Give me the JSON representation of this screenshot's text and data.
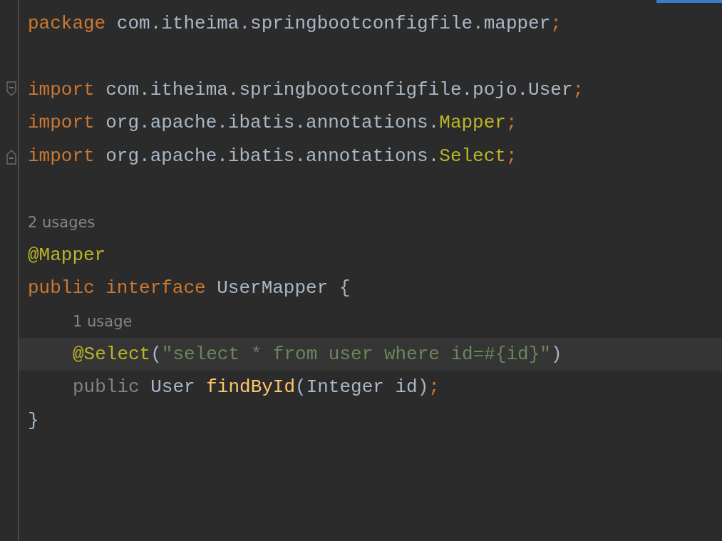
{
  "editor": {
    "lines": [
      {
        "kind": "code",
        "current": false,
        "fold_start": false,
        "fold_end": false,
        "tokens": [
          {
            "text": "package ",
            "kind": "keyword"
          },
          {
            "text": "com.itheima.springbootconfigfile.mapper",
            "kind": "plain"
          },
          {
            "text": ";",
            "kind": "keyword"
          }
        ]
      },
      {
        "kind": "blank"
      },
      {
        "kind": "code",
        "current": false,
        "fold_start": true,
        "fold_end": false,
        "tokens": [
          {
            "text": "import ",
            "kind": "keyword"
          },
          {
            "text": "com.itheima.springbootconfigfile.pojo.User",
            "kind": "plain"
          },
          {
            "text": ";",
            "kind": "keyword"
          }
        ]
      },
      {
        "kind": "code",
        "current": false,
        "fold_start": false,
        "fold_end": false,
        "tokens": [
          {
            "text": "import ",
            "kind": "keyword"
          },
          {
            "text": "org.apache.ibatis.annotations.",
            "kind": "plain"
          },
          {
            "text": "Mapper",
            "kind": "annotation"
          },
          {
            "text": ";",
            "kind": "keyword"
          }
        ]
      },
      {
        "kind": "code",
        "current": false,
        "fold_start": false,
        "fold_end": true,
        "tokens": [
          {
            "text": "import ",
            "kind": "keyword"
          },
          {
            "text": "org.apache.ibatis.annotations.",
            "kind": "plain"
          },
          {
            "text": "Select",
            "kind": "annotation"
          },
          {
            "text": ";",
            "kind": "keyword"
          }
        ]
      },
      {
        "kind": "blank"
      },
      {
        "kind": "hint",
        "current": false,
        "fold_start": false,
        "fold_end": false,
        "text": "2 usages"
      },
      {
        "kind": "code",
        "current": false,
        "fold_start": false,
        "fold_end": false,
        "tokens": [
          {
            "text": "@Mapper",
            "kind": "annotation"
          }
        ]
      },
      {
        "kind": "code",
        "current": false,
        "fold_start": false,
        "fold_end": false,
        "tokens": [
          {
            "text": "public ",
            "kind": "keyword"
          },
          {
            "text": "interface ",
            "kind": "keyword"
          },
          {
            "text": "UserMapper {",
            "kind": "plain"
          }
        ],
        "children": [
          {
            "kind": "hint",
            "current": false,
            "fold_start": false,
            "fold_end": false,
            "text": "1 usage"
          },
          {
            "kind": "code",
            "current": true,
            "fold_start": false,
            "fold_end": false,
            "tokens": [
              {
                "text": "@Select",
                "kind": "annotation"
              },
              {
                "text": "(",
                "kind": "plain"
              },
              {
                "text": "\"select * from user where id=#{id}\"",
                "kind": "string"
              },
              {
                "text": ")",
                "kind": "plain"
              }
            ]
          },
          {
            "kind": "code",
            "current": false,
            "fold_start": false,
            "fold_end": false,
            "tokens": [
              {
                "text": "public ",
                "kind": "muted"
              },
              {
                "text": "User ",
                "kind": "plain"
              },
              {
                "text": "findById",
                "kind": "method"
              },
              {
                "text": "(Integer id)",
                "kind": "plain"
              },
              {
                "text": ";",
                "kind": "keyword"
              }
            ]
          }
        ]
      },
      {
        "kind": "code",
        "current": false,
        "fold_start": false,
        "fold_end": false,
        "tokens": [
          {
            "text": "}",
            "kind": "plain"
          }
        ]
      }
    ]
  }
}
